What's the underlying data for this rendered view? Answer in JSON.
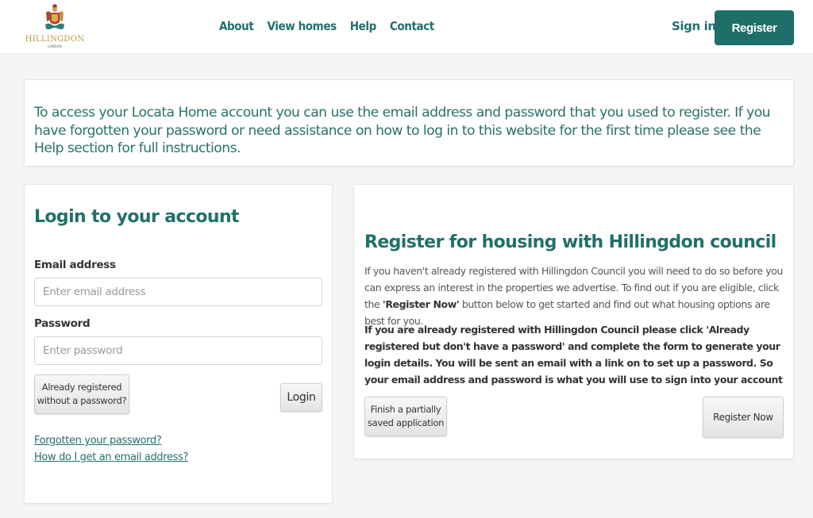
{
  "header": {
    "logo": {
      "name": "HILLINGDON",
      "sub": "LONDON"
    },
    "nav": [
      {
        "label": "About"
      },
      {
        "label": "View homes"
      },
      {
        "label": "Help"
      },
      {
        "label": "Contact"
      }
    ],
    "sign_in_label": "Sign in",
    "register_label": "Register"
  },
  "info": {
    "text": "To access your Locata Home account you can use the email address and password that you used to register. If you have forgotten your password or need assistance on how to log in to this website for the first time please see the Help section for full instructions."
  },
  "login": {
    "title": "Login to your account",
    "email_label": "Email address",
    "email_placeholder": "Enter email address",
    "email_value": "",
    "password_label": "Password",
    "password_placeholder": "Enter password",
    "password_value": "",
    "already_registered_line1": "Already registered",
    "already_registered_line2": "without a password?",
    "login_button": "Login",
    "forgot_link": "Forgotten your password?",
    "email_help_link": "How do I get an email address?"
  },
  "register": {
    "title": "Register for housing with Hillingdon council",
    "intro_part1": "If you haven't already registered with Hillingdon Council you will need to do so before you can express an interest in the properties we advertise. To find out if you are eligible, click the ",
    "intro_bold": "'Register Now'",
    "intro_part2": " button below to get started and find out what housing options are best for you.",
    "bold_text": "If you are already registered with Hillingdon Council please click 'Already registered but don't have a password' and complete the form to generate your login details. You will be sent an email with a link on to set up a password.  So your email address and password is what you will use to sign into your account",
    "finish_line1": "Finish a partially",
    "finish_line2": "saved application",
    "register_now_button": "Register Now"
  },
  "colors": {
    "brand": "#1d6f68",
    "link": "#21706a",
    "logo_gold": "#b9993f",
    "background": "#f5f5f5"
  }
}
